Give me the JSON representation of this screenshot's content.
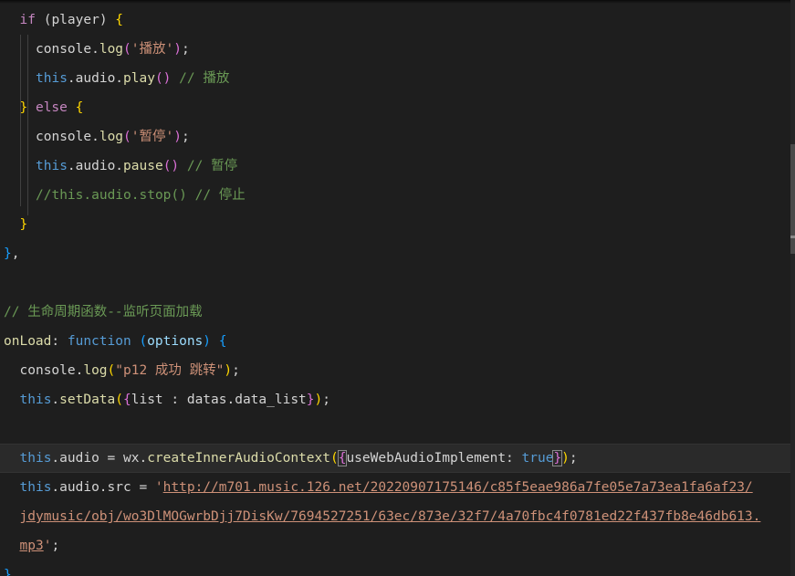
{
  "editor": {
    "lines": [
      {
        "indent": 1,
        "tokens": [
          [
            "ctl",
            "if"
          ],
          [
            "plain",
            " ("
          ],
          [
            "plain",
            "player"
          ],
          [
            "plain",
            ") "
          ],
          [
            "y1",
            "{"
          ]
        ]
      },
      {
        "indent": 2,
        "tokens": [
          [
            "plain",
            "console."
          ],
          [
            "fn",
            "log"
          ],
          [
            "y2",
            "("
          ],
          [
            "str",
            "'播放'"
          ],
          [
            "y2",
            ")"
          ],
          [
            "plain",
            ";"
          ]
        ]
      },
      {
        "indent": 2,
        "tokens": [
          [
            "kw",
            "this"
          ],
          [
            "plain",
            ".audio."
          ],
          [
            "fn",
            "play"
          ],
          [
            "y2",
            "()"
          ],
          [
            "cmt",
            " // 播放"
          ]
        ]
      },
      {
        "indent": 1,
        "tokens": [
          [
            "y1",
            "}"
          ],
          [
            "ctl",
            " else"
          ],
          [
            "plain",
            " "
          ],
          [
            "y1",
            "{"
          ]
        ]
      },
      {
        "indent": 2,
        "tokens": [
          [
            "plain",
            "console."
          ],
          [
            "fn",
            "log"
          ],
          [
            "y2",
            "("
          ],
          [
            "str",
            "'暂停'"
          ],
          [
            "y2",
            ")"
          ],
          [
            "plain",
            ";"
          ]
        ]
      },
      {
        "indent": 2,
        "tokens": [
          [
            "kw",
            "this"
          ],
          [
            "plain",
            ".audio."
          ],
          [
            "fn",
            "pause"
          ],
          [
            "y2",
            "()"
          ],
          [
            "cmt",
            " // 暂停"
          ]
        ]
      },
      {
        "indent": 2,
        "tokens": [
          [
            "cmt",
            "//this.audio.stop() // 停止"
          ]
        ]
      },
      {
        "indent": 1,
        "tokens": [
          [
            "y1",
            "}"
          ]
        ]
      },
      {
        "indent": 0,
        "tokens": [
          [
            "y3",
            "}"
          ],
          [
            "plain",
            ","
          ]
        ]
      },
      {
        "indent": 0,
        "tokens": []
      },
      {
        "indent": 0,
        "tokens": [
          [
            "cmt",
            "// 生命周期函数--监听页面加载"
          ]
        ]
      },
      {
        "indent": 0,
        "tokens": [
          [
            "fn",
            "onLoad"
          ],
          [
            "plain",
            ": "
          ],
          [
            "kw",
            "function"
          ],
          [
            "plain",
            " "
          ],
          [
            "y3",
            "("
          ],
          [
            "prop",
            "options"
          ],
          [
            "y3",
            ")"
          ],
          [
            "plain",
            " "
          ],
          [
            "y3",
            "{"
          ]
        ]
      },
      {
        "indent": 1,
        "tokens": [
          [
            "plain",
            "console."
          ],
          [
            "fn",
            "log"
          ],
          [
            "y1",
            "("
          ],
          [
            "str",
            "\"p12 成功 跳转\""
          ],
          [
            "y1",
            ")"
          ],
          [
            "plain",
            ";"
          ]
        ]
      },
      {
        "indent": 1,
        "tokens": [
          [
            "kw",
            "this"
          ],
          [
            "plain",
            "."
          ],
          [
            "fn",
            "setData"
          ],
          [
            "y1",
            "("
          ],
          [
            "y2",
            "{"
          ],
          [
            "plain",
            "list : datas.data_list"
          ],
          [
            "y2",
            "}"
          ],
          [
            "y1",
            ")"
          ],
          [
            "plain",
            ";"
          ]
        ]
      },
      {
        "indent": 0,
        "tokens": []
      },
      {
        "indent": 1,
        "current": true,
        "tokens": [
          [
            "kw",
            "this"
          ],
          [
            "plain",
            ".audio = wx."
          ],
          [
            "fn",
            "createInnerAudioContext"
          ],
          [
            "y1",
            "("
          ],
          [
            "y2box",
            "{"
          ],
          [
            "plain",
            "useWebAudioImplement: "
          ],
          [
            "kw",
            "true"
          ],
          [
            "y2box",
            "}"
          ],
          [
            "y1",
            ")"
          ],
          [
            "plain",
            ";"
          ]
        ]
      },
      {
        "indent": 1,
        "tokens": [
          [
            "kw",
            "this"
          ],
          [
            "plain",
            ".audio.src = "
          ],
          [
            "str",
            "'"
          ],
          [
            "url",
            "http://m701.music.126.net/20220907175146/c85f5eae986a7fe05e7a73ea1fa6af23/"
          ]
        ]
      },
      {
        "indent": 1,
        "tokens": [
          [
            "url",
            "jdymusic/obj/wo3DlMOGwrbDjj7DisKw/7694527251/63ec/873e/32f7/4a70fbc4f0781ed22f437fb8e46db613."
          ]
        ]
      },
      {
        "indent": 1,
        "tokens": [
          [
            "url",
            "mp3"
          ],
          [
            "str",
            "'"
          ],
          [
            "plain",
            ";"
          ]
        ]
      },
      {
        "indent": 0,
        "tokens": [
          [
            "y3",
            "}"
          ]
        ]
      }
    ]
  }
}
